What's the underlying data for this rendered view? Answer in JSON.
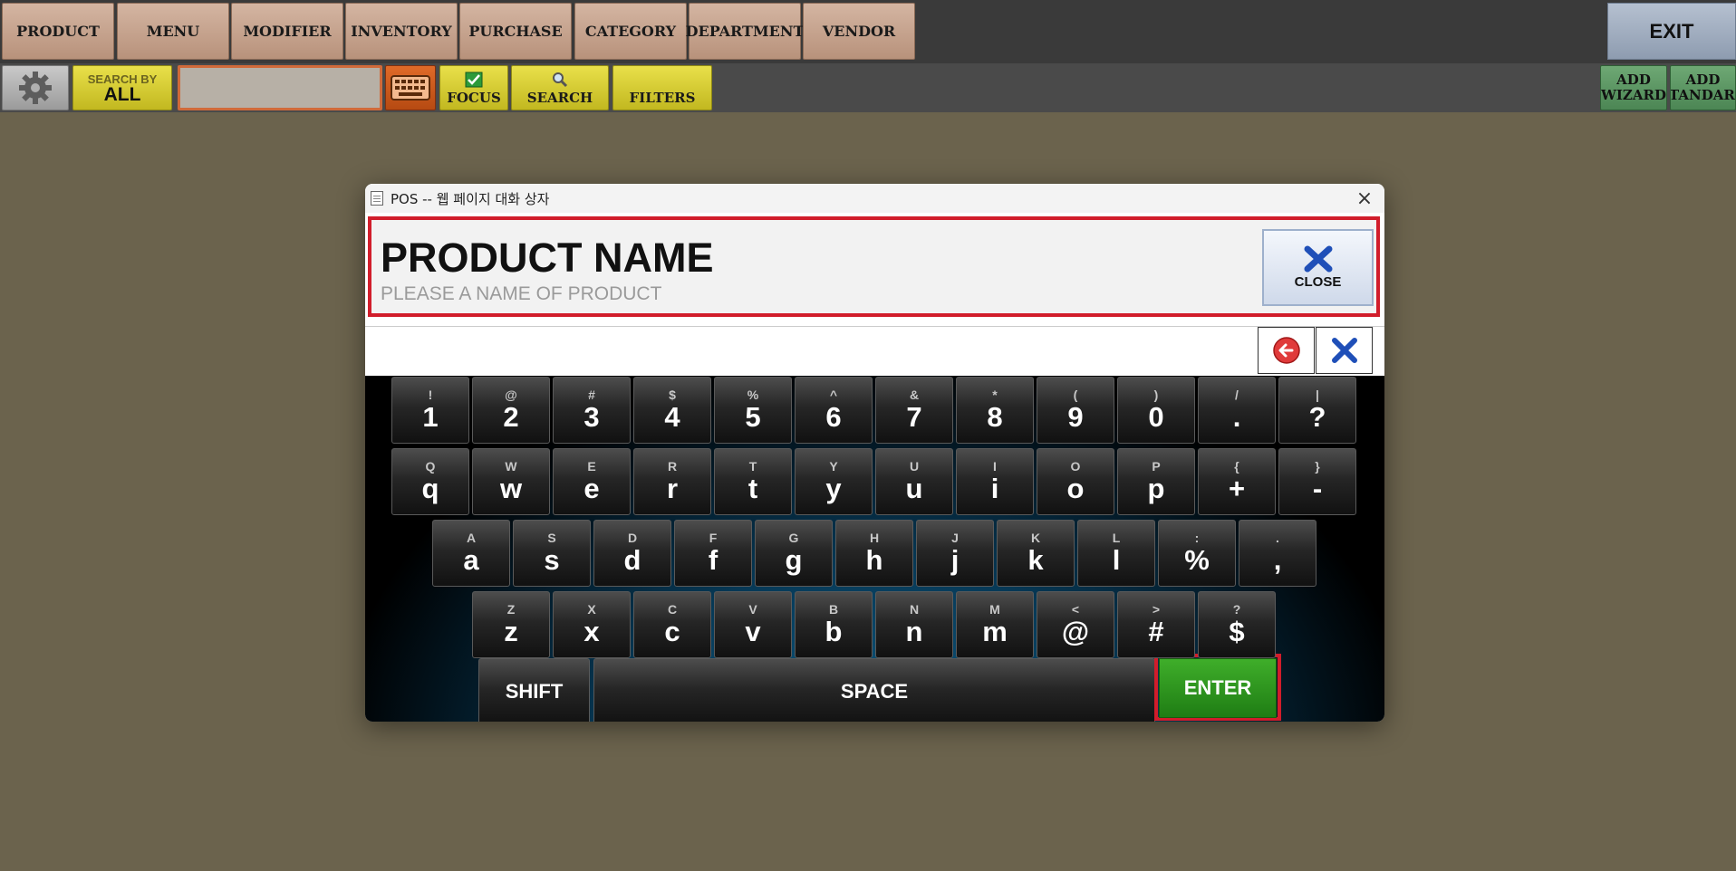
{
  "nav": {
    "items": [
      "PRODUCT",
      "MENU",
      "MODIFIER",
      "INVENTORY",
      "PURCHASE",
      "CATEGORY",
      "DEPARTMENT",
      "VENDOR"
    ],
    "exit_label": "EXIT"
  },
  "toolbar": {
    "search_by_label": "SEARCH BY",
    "search_by_value": "ALL",
    "search_value": "",
    "focus_label": "FOCUS",
    "search_label": "SEARCH",
    "filters_label": "FILTERS",
    "add_wizard_label": [
      "ADD",
      "WIZARD"
    ],
    "add_standard_label": [
      "ADD",
      "STANDARD"
    ]
  },
  "dialog": {
    "title": "POS -- 웹 페이지 대화 상자",
    "close_x": "×",
    "heading": "PRODUCT NAME",
    "subheading": "PLEASE A NAME OF PRODUCT",
    "close_label": "CLOSE",
    "input_value": ""
  },
  "keyboard": {
    "rows": [
      [
        [
          "!",
          "1"
        ],
        [
          "@",
          "2"
        ],
        [
          "#",
          "3"
        ],
        [
          "$",
          "4"
        ],
        [
          "%",
          "5"
        ],
        [
          "^",
          "6"
        ],
        [
          "&",
          "7"
        ],
        [
          "*",
          "8"
        ],
        [
          "(",
          "9"
        ],
        [
          ")",
          "0"
        ],
        [
          "/",
          "."
        ],
        [
          "|",
          "?"
        ]
      ],
      [
        [
          "Q",
          "q"
        ],
        [
          "W",
          "w"
        ],
        [
          "E",
          "e"
        ],
        [
          "R",
          "r"
        ],
        [
          "T",
          "t"
        ],
        [
          "Y",
          "y"
        ],
        [
          "U",
          "u"
        ],
        [
          "I",
          "i"
        ],
        [
          "O",
          "o"
        ],
        [
          "P",
          "p"
        ],
        [
          "{",
          "+"
        ],
        [
          "}",
          "-"
        ]
      ],
      [
        [
          "A",
          "a"
        ],
        [
          "S",
          "s"
        ],
        [
          "D",
          "d"
        ],
        [
          "F",
          "f"
        ],
        [
          "G",
          "g"
        ],
        [
          "H",
          "h"
        ],
        [
          "J",
          "j"
        ],
        [
          "K",
          "k"
        ],
        [
          "L",
          "l"
        ],
        [
          ":",
          "%"
        ],
        [
          ".",
          ","
        ]
      ],
      [
        [
          "Z",
          "z"
        ],
        [
          "X",
          "x"
        ],
        [
          "C",
          "c"
        ],
        [
          "V",
          "v"
        ],
        [
          "B",
          "b"
        ],
        [
          "N",
          "n"
        ],
        [
          "M",
          "m"
        ],
        [
          "<",
          "@"
        ],
        [
          ">",
          "#"
        ],
        [
          "?",
          "$"
        ]
      ]
    ],
    "shift_label": "SHIFT",
    "space_label": "SPACE",
    "enter_label": "ENTER"
  },
  "colors": {
    "background": "#6b634d",
    "highlight": "#d11d2b",
    "enter": "#2a9a1e",
    "nav_button": "#c9a48f",
    "yellow_button": "#d8ce32",
    "green_button": "#5f9a66"
  },
  "icons": {
    "settings": "gear-icon",
    "keyboard": "keyboard-icon",
    "focus": "checkbox-icon",
    "search": "magnifier-icon",
    "close": "x-icon",
    "backspace": "back-arrow-icon",
    "clear": "x-icon"
  }
}
